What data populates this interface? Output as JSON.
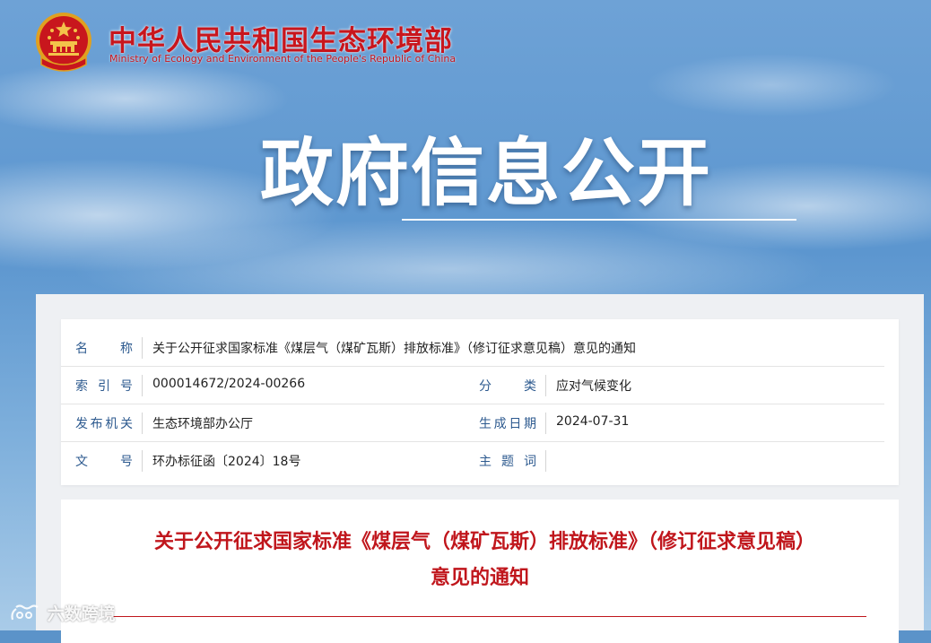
{
  "header": {
    "site_name_cn": "中华人民共和国生态环境部",
    "site_name_en": "Ministry of Ecology and Environment of the People's Republic of China",
    "emblem_icon": "national-emblem-icon"
  },
  "banner": {
    "title": "政府信息公开"
  },
  "meta": {
    "name_label": "名称",
    "name_value": "关于公开征求国家标准《煤层气（煤矿瓦斯）排放标准》（修订征求意见稿）意见的通知",
    "index_label": "索引号",
    "index_value": "000014672/2024-00266",
    "category_label": "分类",
    "category_value": "应对气候变化",
    "issuer_label": "发布机关",
    "issuer_value": "生态环境部办公厅",
    "date_label": "生成日期",
    "date_value": "2024-07-31",
    "doc_no_label": "文号",
    "doc_no_value": "环办标征函〔2024〕18号",
    "keywords_label": "主题词",
    "keywords_value": ""
  },
  "article": {
    "title": "关于公开征求国家标准《煤层气（煤矿瓦斯）排放标准》（修订征求意见稿）意见的通知"
  },
  "watermark": {
    "text": "六数跨境"
  },
  "colors": {
    "brand_red": "#c8161d",
    "label_blue": "#2d5a8f"
  }
}
